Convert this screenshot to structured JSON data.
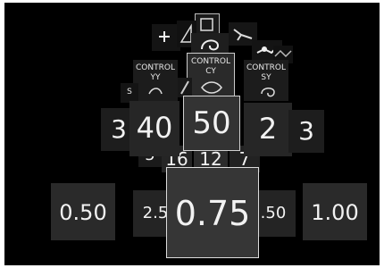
{
  "control_tiles": {
    "left": {
      "line1": "CONTROL",
      "line2": "YY"
    },
    "center": {
      "line1": "CONTROL",
      "line2": "CY"
    },
    "right": {
      "line1": "CONTROL",
      "line2": "SY"
    },
    "far_left_partial": "S"
  },
  "row_upper": {
    "far_left": "3",
    "left": "40",
    "center": "50",
    "right": "2",
    "far_right": "3"
  },
  "row_middle": {
    "left_partial": "5",
    "left": "16",
    "center": "12",
    "right": "7"
  },
  "row_lower": {
    "far_left": "0.50",
    "left": "2.5",
    "center": "0.75",
    "right": ".50",
    "far_right": "1.00"
  },
  "icons": [
    "plus-icon",
    "triangle-icon",
    "square-frame-icon",
    "cable-icon",
    "plug-icon",
    "wave-icon",
    "swirl-icon",
    "eye-icon",
    "pencil-icon"
  ]
}
